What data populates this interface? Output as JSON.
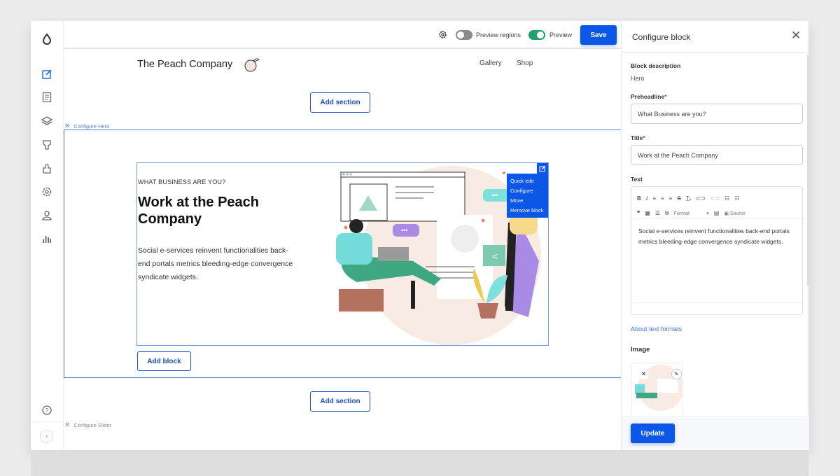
{
  "sidebar": {
    "items": [
      "logo-drop",
      "edit",
      "pages",
      "layers",
      "brush",
      "extensions",
      "settings",
      "user",
      "reports"
    ],
    "help": "help",
    "expand": "expand"
  },
  "topbar": {
    "preview_regions_label": "Preview regions",
    "preview_regions_on": false,
    "preview_label": "Preview",
    "preview_on": true,
    "save_label": "Save"
  },
  "site": {
    "brand": "The Peach Company",
    "nav": [
      "Gallery",
      "Shop"
    ]
  },
  "canvas": {
    "add_section": "Add section",
    "configure_hero": "Configure Hero",
    "configure_slider": "Configure Slider",
    "add_block": "Add block",
    "hero": {
      "preheadline": "WHAT BUSINESS ARE YOU?",
      "title": "Work at the Peach Company",
      "text": "Social e-services reinvent functionalities back-end portals metrics bleeding-edge convergence syndicate widgets."
    },
    "context_menu": [
      "Quick edit",
      "Configure",
      "Move",
      "Remove block"
    ]
  },
  "panel": {
    "title": "Configure block",
    "block_description_label": "Block description",
    "block_description": "Hero",
    "preheadline_label": "Preheadline",
    "preheadline_value": "What Business are you?",
    "title_label": "Title",
    "title_value": "Work at the Peach Company",
    "text_label": "Text",
    "toolbar": {
      "format": "Format",
      "source": "Source"
    },
    "text_value": "Social e-services reinvent functionalities back-end portals metrics bleeding-edge convergence syndicate widgets.",
    "about_formats": "About text formats",
    "image_label": "Image",
    "update_label": "Update"
  },
  "colors": {
    "accent": "#0a57e8",
    "toggle_on": "#22a06b",
    "peach": "#f8ebe4"
  }
}
